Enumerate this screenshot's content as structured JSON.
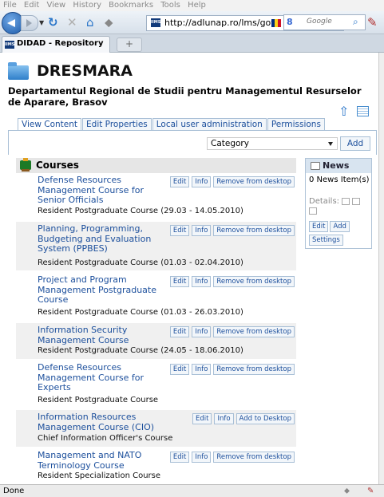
{
  "browser": {
    "menu": [
      "File",
      "Edit",
      "View",
      "History",
      "Bookmarks",
      "Tools",
      "Help"
    ],
    "url": "http://adlunap.ro/lms/got",
    "search_placeholder": "Google",
    "google_icon_text": "8",
    "tab_title": "DIDAD - Repository",
    "new_tab_label": "+",
    "icons": [
      "back-icon",
      "forward-icon",
      "reload-icon",
      "stop-icon",
      "home-icon",
      "bookmark-star-icon",
      "search-icon"
    ],
    "status": "Done"
  },
  "page": {
    "title": "DRESMARA",
    "subtitle": "Departamentul Regional de Studii pentru Managementul Resurselor de Aparare, Brasov",
    "tabs": [
      "View Content",
      "Edit Properties",
      "Local user administration",
      "Permissions"
    ],
    "category_select": "Category",
    "add_label": "Add"
  },
  "courses": {
    "heading": "Courses",
    "items": [
      {
        "title": "Defense Resources Management Course for Senior Officials",
        "desc": "Resident Postgraduate Course (29.03 - 14.05.2010)",
        "actions": [
          "Edit",
          "Info",
          "Remove from desktop"
        ]
      },
      {
        "title": "Planning, Programming, Budgeting and Evaluation System (PPBES)",
        "desc": "Resident Postgraduate Course (01.03 - 02.04.2010)",
        "actions": [
          "Edit",
          "Info",
          "Remove from desktop"
        ]
      },
      {
        "title": "Project and Program Management Postgraduate Course",
        "desc": "Resident Postgraduate Course (01.03 - 26.03.2010)",
        "actions": [
          "Edit",
          "Info",
          "Remove from desktop"
        ]
      },
      {
        "title": "Information Security Management Course",
        "desc": "Resident Postgraduate Course (24.05 - 18.06.2010)",
        "actions": [
          "Edit",
          "Info",
          "Remove from desktop"
        ]
      },
      {
        "title": "Defense Resources Management Course for Experts",
        "desc": "Resident Postgraduate Course",
        "actions": [
          "Edit",
          "Info",
          "Remove from desktop"
        ]
      },
      {
        "title": "Information Resources Management Course (CIO)",
        "desc": "Chief Information Officer's Course",
        "actions": [
          "Edit",
          "Info",
          "Add to Desktop"
        ]
      },
      {
        "title": "Management and NATO Terminology Course",
        "desc": "Resident Specialization Course",
        "actions": [
          "Edit",
          "Info",
          "Remove from desktop"
        ]
      }
    ]
  },
  "news": {
    "heading": "News",
    "count": "0 News Item(s)",
    "details_label": "Details:",
    "buttons": [
      "Edit",
      "Add",
      "Settings"
    ]
  }
}
